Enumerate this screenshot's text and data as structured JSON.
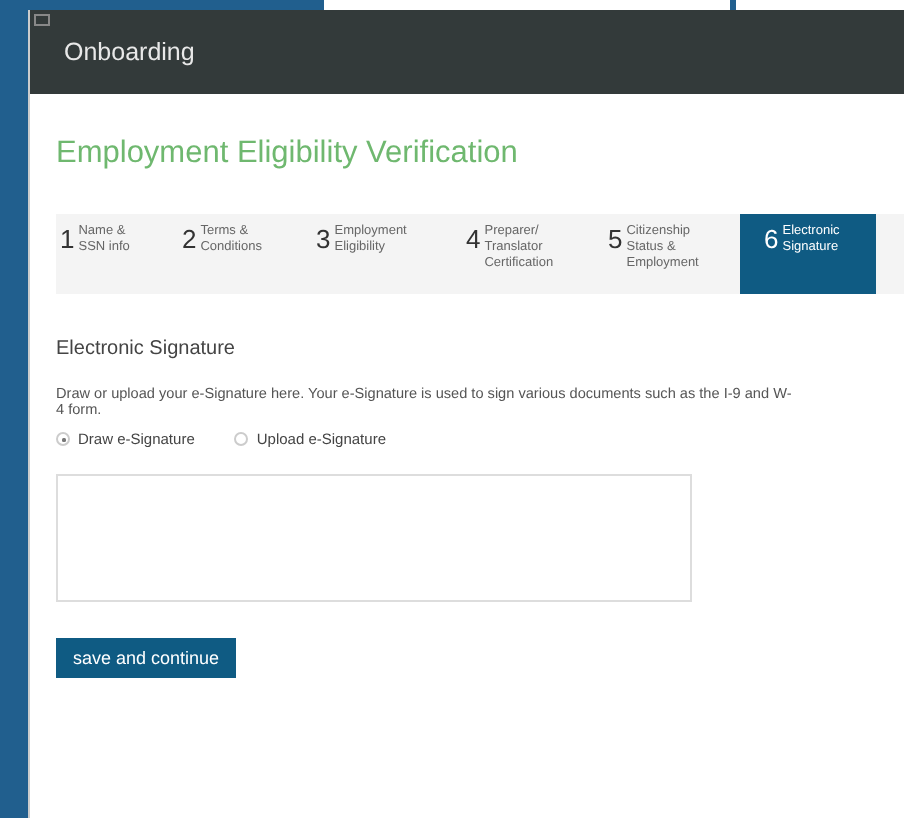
{
  "window": {
    "title": "Onboarding"
  },
  "page_title": "Employment Eligibility Verification",
  "steps": [
    {
      "number": "1",
      "label": "Name &\nSSN info",
      "selected": false
    },
    {
      "number": "2",
      "label": "Terms &\nConditions",
      "selected": false
    },
    {
      "number": "3",
      "label": "Employment\nEligibility",
      "selected": false
    },
    {
      "number": "4",
      "label": "Preparer/\nTranslator\nCertification",
      "selected": false
    },
    {
      "number": "5",
      "label": "Citizenship\nStatus &\nEmployment",
      "selected": false
    },
    {
      "number": "6",
      "label": "Electronic\nSignature",
      "selected": true
    }
  ],
  "section_title": "Electronic Signature",
  "description": "Draw or upload your e-Signature here. Your e-Signature is used to sign various documents such as the I-9 and W-4 form.",
  "options": [
    {
      "label": "Draw e-Signature",
      "selected": true
    },
    {
      "label": "Upload e-Signature",
      "selected": false
    }
  ],
  "button": "save and continue"
}
